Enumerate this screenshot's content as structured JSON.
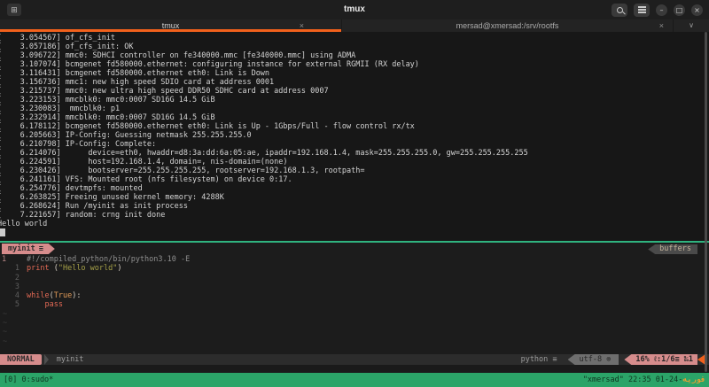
{
  "colors": {
    "accent_orange": "#F2611C",
    "salmon": "#D68C8C",
    "teal_divider": "#2FB37F",
    "tmux_green": "#2BA468",
    "month_orange": "#F0A030",
    "terminal_bg": "#171717",
    "terminal_fg": "#D3D3D3"
  },
  "titlebar": {
    "title": "tmux",
    "new_tab_icon": "⊞",
    "min_icon": "–",
    "max_icon": "□",
    "close_icon": "×"
  },
  "tabbar": {
    "tabs": [
      {
        "label": "tmux",
        "close_icon": "×",
        "active": true
      },
      {
        "label": "mersad@xmersad:/srv/rootfs",
        "close_icon": "×",
        "active": false
      }
    ],
    "dropdown_icon": "∨"
  },
  "terminal": {
    "lines": [
      "[    3.054567] of_cfs_init",
      "[    3.057186] of_cfs_init: OK",
      "[    3.096722] mmc0: SDHCI controller on fe340000.mmc [fe340000.mmc] using ADMA",
      "[    3.107074] bcmgenet fd580000.ethernet: configuring instance for external RGMII (RX delay)",
      "[    3.116431] bcmgenet fd580000.ethernet eth0: Link is Down",
      "[    3.156736] mmc1: new high speed SDIO card at address 0001",
      "[    3.215737] mmc0: new ultra high speed DDR50 SDHC card at address 0007",
      "[    3.223153] mmcblk0: mmc0:0007 SD16G 14.5 GiB",
      "[    3.230083]  mmcblk0: p1",
      "[    3.232914] mmcblk0: mmc0:0007 SD16G 14.5 GiB",
      "[    6.178112] bcmgenet fd580000.ethernet eth0: Link is Up - 1Gbps/Full - flow control rx/tx",
      "[    6.205663] IP-Config: Guessing netmask 255.255.255.0",
      "[    6.210798] IP-Config: Complete:",
      "[    6.214076]      device=eth0, hwaddr=d8:3a:dd:6a:05:ae, ipaddr=192.168.1.4, mask=255.255.255.0, gw=255.255.255.255",
      "[    6.224591]      host=192.168.1.4, domain=, nis-domain=(none)",
      "[    6.230426]      bootserver=255.255.255.255, rootserver=192.168.1.3, rootpath=",
      "[    6.241161] VFS: Mounted root (nfs filesystem) on device 0:17.",
      "[    6.254776] devtmpfs: mounted",
      "[    6.263825] Freeing unused kernel memory: 4288K",
      "[    6.268624] Run /myinit as init process",
      "[    7.221657] random: crng init done",
      "Hello world"
    ]
  },
  "editor": {
    "buffer_tab": {
      "label": "myinit",
      "icon": "≡"
    },
    "buffers_label": "buffers",
    "lines": [
      {
        "num": "1",
        "num_type": "abs",
        "tokens": [
          [
            "#!/compiled_python/bin/python3.10 -E",
            "comment"
          ]
        ]
      },
      {
        "num": "1",
        "num_type": "rel",
        "tokens": [
          [
            "print",
            "kw"
          ],
          [
            " (",
            "pn"
          ],
          [
            "\"Hello world\"",
            "str"
          ],
          [
            ")",
            "pn"
          ]
        ]
      },
      {
        "num": "2",
        "num_type": "rel",
        "tokens": []
      },
      {
        "num": "3",
        "num_type": "rel",
        "tokens": []
      },
      {
        "num": "4",
        "num_type": "rel",
        "tokens": [
          [
            "while",
            "kw"
          ],
          [
            "(",
            "pn"
          ],
          [
            "True",
            "const"
          ],
          [
            "):",
            "pn"
          ]
        ]
      },
      {
        "num": "5",
        "num_type": "rel",
        "tokens": [
          [
            "    ",
            "pn"
          ],
          [
            "pass",
            "kw"
          ]
        ]
      }
    ],
    "tilde": "~",
    "tilde_count": 4
  },
  "statusline": {
    "mode": "NORMAL",
    "file": "myinit",
    "filetype": "python",
    "filetype_icon": "≡",
    "encoding": "utf-8",
    "encoding_icon": "⊗",
    "position": "16% ℓ:1/6≡ ‰1"
  },
  "tmux_bar": {
    "left": "[0] 0:sudo*",
    "right_prefix": "\"xmersad\" 22:35 01-24-",
    "month": "فوریه"
  }
}
